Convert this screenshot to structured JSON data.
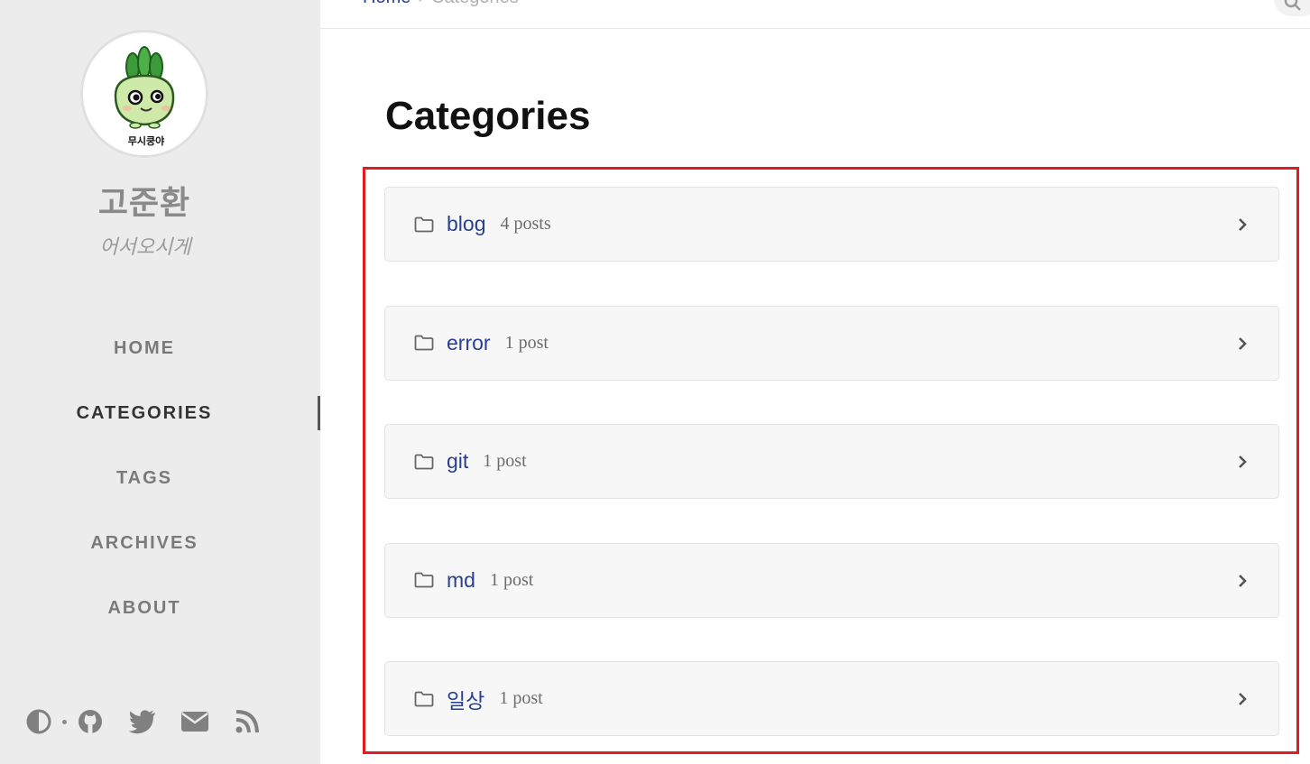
{
  "sidebar": {
    "avatar_caption": "무시쿵야",
    "title": "고준환",
    "subtitle": "어서오시게",
    "nav": [
      {
        "label": "HOME"
      },
      {
        "label": "CATEGORIES"
      },
      {
        "label": "TAGS"
      },
      {
        "label": "ARCHIVES"
      },
      {
        "label": "ABOUT"
      }
    ],
    "footer_icons": [
      "theme-toggle-icon",
      "github-icon",
      "twitter-icon",
      "email-icon",
      "rss-icon"
    ]
  },
  "topbar": {
    "breadcrumb_home": "Home",
    "breadcrumb_separator": "›",
    "breadcrumb_current": "Categories"
  },
  "main": {
    "title": "Categories",
    "categories": [
      {
        "name": "blog",
        "count": "4 posts"
      },
      {
        "name": "error",
        "count": "1 post"
      },
      {
        "name": "git",
        "count": "1 post"
      },
      {
        "name": "md",
        "count": "1 post"
      },
      {
        "name": "일상",
        "count": "1 post"
      }
    ]
  },
  "colors": {
    "link": "#2a408e",
    "sidebar_bg": "#ececec",
    "highlight": "#e01b24"
  }
}
